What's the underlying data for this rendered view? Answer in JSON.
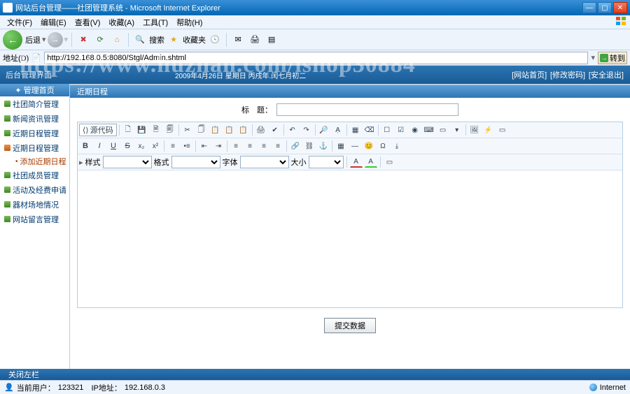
{
  "ie": {
    "title": "网站后台管理——社团管理系统 - Microsoft Internet Explorer",
    "menu": [
      "文件(F)",
      "编辑(E)",
      "查看(V)",
      "收藏(A)",
      "工具(T)",
      "帮助(H)"
    ],
    "back": "后退",
    "search": "搜索",
    "favorites": "收藏夹",
    "address_label": "地址(D)",
    "address_value": "http://192.168.0.5:8080/Stgl/Admin.shtml",
    "go": "转到"
  },
  "banner": {
    "left": "后台管理界面",
    "date": "2009年4月26日 星期日 丙戌年.闰七月初二",
    "links": [
      "[网站首页]",
      "[修改密码]",
      "[安全退出]"
    ]
  },
  "watermark": "https://www.huzhan.com/ishop30884",
  "sidebar": {
    "header": "管理首页",
    "items": [
      {
        "label": "社团简介管理"
      },
      {
        "label": "新闻资讯管理"
      },
      {
        "label": "近期日程管理"
      },
      {
        "label": "近期日程管理",
        "sel": true
      },
      {
        "label": "添加近期日程",
        "sub": true
      },
      {
        "label": "社团成员管理"
      },
      {
        "label": "活动及经费申请"
      },
      {
        "label": "器材场地情况"
      },
      {
        "label": "网站留言管理"
      }
    ]
  },
  "content": {
    "panel_title": "近期日程",
    "title_label": "标　题：",
    "title_value": "",
    "source_code": "源代码",
    "sel_style": "样式",
    "sel_format": "格式",
    "sel_font": "字体",
    "sel_size": "大小",
    "submit": "提交数据"
  },
  "footer": {
    "collapse": "关闭左栏",
    "status_user_label": "当前用户：",
    "status_user": "123321",
    "status_ip_label": "IP地址：",
    "status_ip": "192.168.0.3",
    "internet": "Internet"
  }
}
